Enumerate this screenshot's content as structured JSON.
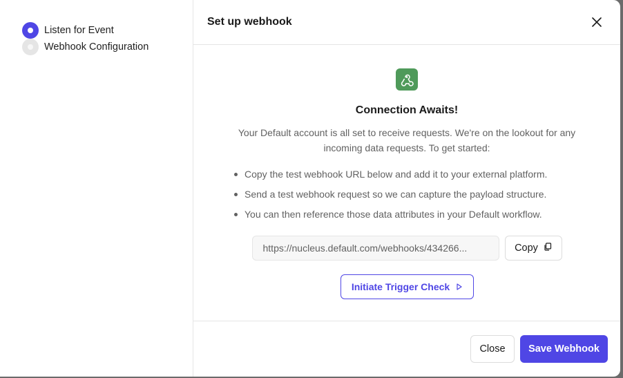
{
  "stepper": {
    "steps": [
      {
        "label": "Listen for Event",
        "state": "active"
      },
      {
        "label": "Webhook Configuration",
        "state": "pending"
      }
    ]
  },
  "dialog": {
    "title": "Set up webhook",
    "close_icon": "close-icon"
  },
  "content": {
    "icon": "webhook-icon",
    "heading": "Connection Awaits!",
    "description": "Your Default account is all set to receive requests. We're on the lookout for any incoming data requests. To get started:",
    "bullets": [
      "Copy the test webhook URL below and add it to your external platform.",
      "Send a test webhook request so we can capture the payload structure.",
      "You can then reference those data attributes in your Default workflow."
    ],
    "url_value": "https://nucleus.default.com/webhooks/434266...",
    "copy_label": "Copy",
    "trigger_label": "Initiate Trigger Check"
  },
  "footer": {
    "close_label": "Close",
    "save_label": "Save Webhook"
  },
  "colors": {
    "accent": "#4f46e5",
    "icon_bg": "#4f9a5a"
  }
}
